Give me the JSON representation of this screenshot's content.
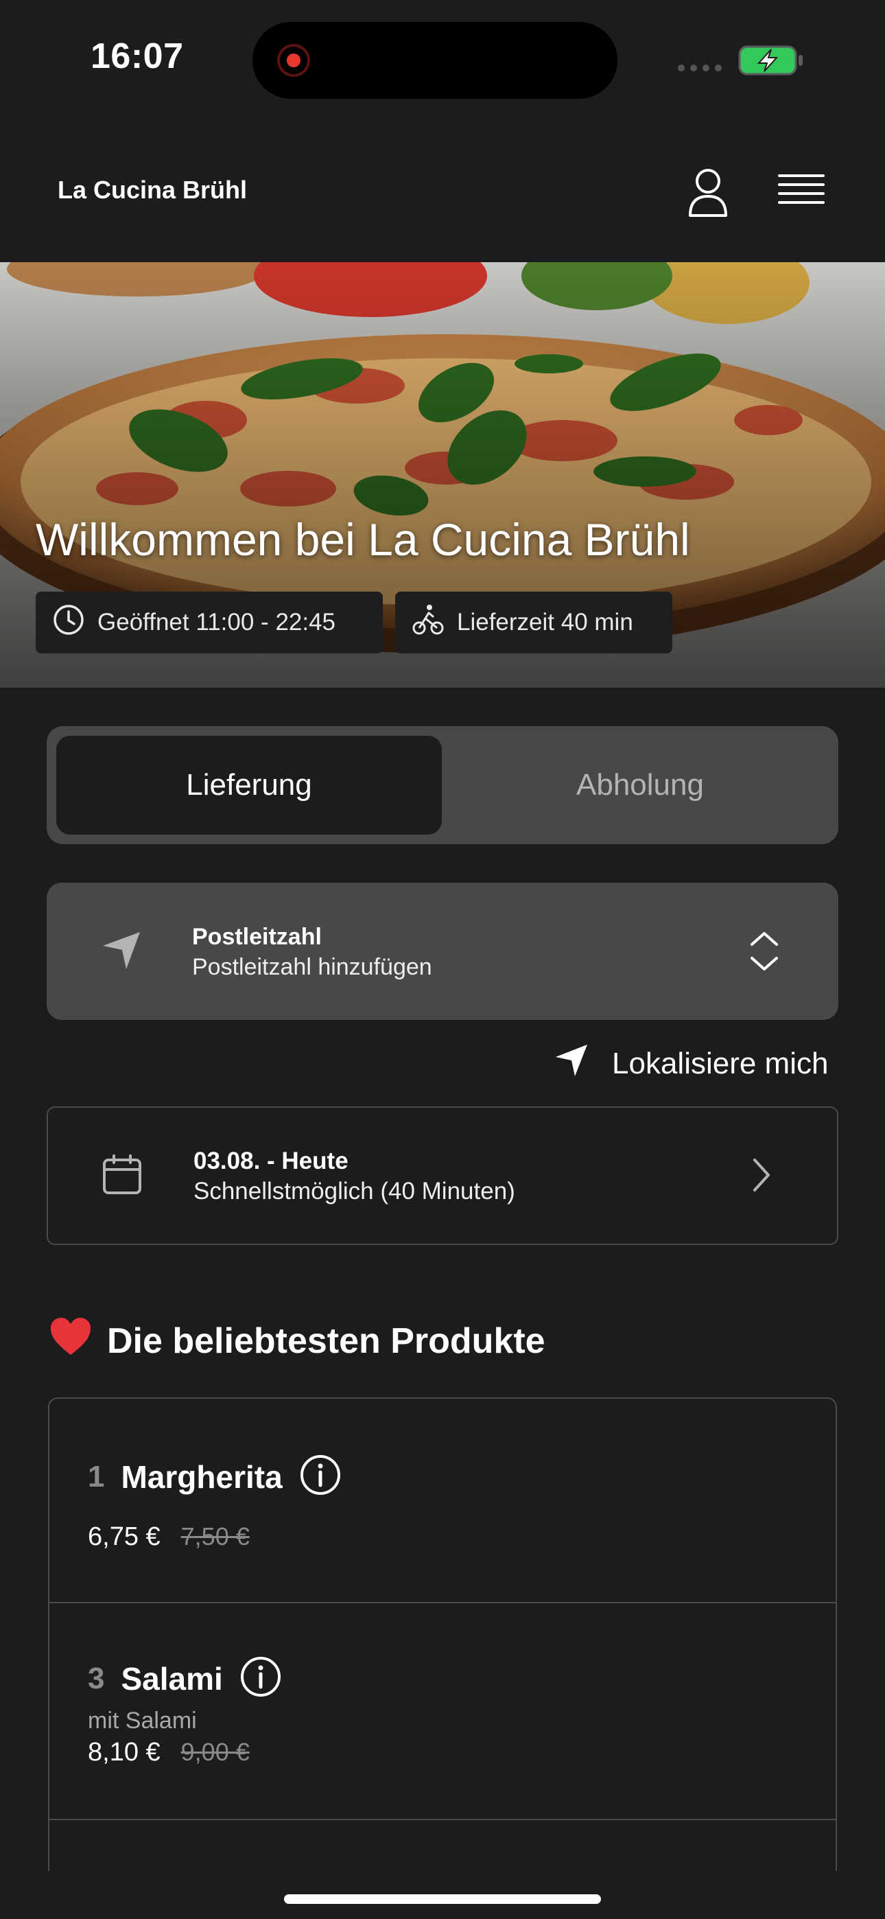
{
  "status_bar": {
    "time": "16:07"
  },
  "header": {
    "brand": "La Cucina Brühl",
    "profile_icon": "person-icon",
    "menu_icon": "hamburger-menu-icon"
  },
  "hero": {
    "title": "Willkommen bei La Cucina Brühl",
    "open_hours": "Geöffnet 11:00 - 22:45",
    "delivery_time": "Lieferzeit 40 min"
  },
  "order_mode": {
    "tabs": [
      "Lieferung",
      "Abholung"
    ],
    "selected": "Lieferung"
  },
  "postcode": {
    "label": "Postleitzahl",
    "placeholder": "Postleitzahl hinzufügen"
  },
  "locate": {
    "label": "Lokalisiere mich"
  },
  "date": {
    "title": "03.08. - Heute",
    "subtitle": "Schnellstmöglich (40 Minuten)"
  },
  "popular": {
    "title": "Die beliebtesten Produkte",
    "emoji": "❤️",
    "items": [
      {
        "number": "1",
        "name": "Margherita",
        "description": "",
        "price": "6,75 €",
        "old_price": "7,50 €"
      },
      {
        "number": "3",
        "name": "Salami",
        "description": "mit Salami",
        "price": "8,10 €",
        "old_price": "9,00 €"
      }
    ]
  },
  "colors": {
    "background": "#1c1b1d",
    "card": "#48474a",
    "text": "#ffffff",
    "muted": "#8a8a8c"
  }
}
